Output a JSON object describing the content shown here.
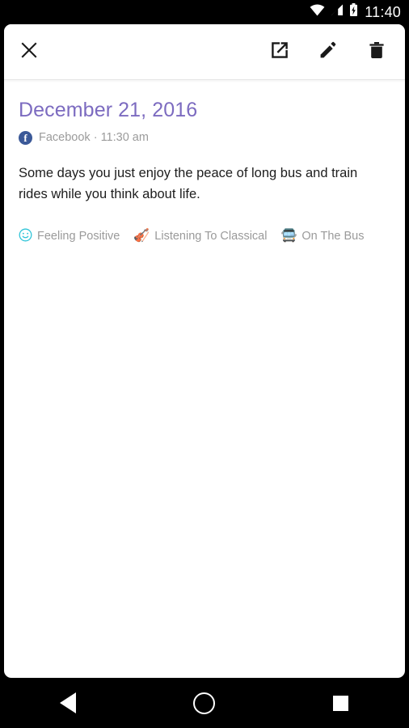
{
  "status_bar": {
    "time": "11:40",
    "icons": [
      "wifi-icon",
      "cellular-signal-icon",
      "battery-charging-icon"
    ]
  },
  "toolbar": {
    "close_label": "close-icon",
    "share_label": "open-in-new-icon",
    "edit_label": "edit-pencil-icon",
    "delete_label": "delete-trash-icon"
  },
  "entry": {
    "title": "December 21, 2016",
    "source": "Facebook",
    "separator": "·",
    "time": "11:30 am",
    "meta": "Facebook · 11:30 am",
    "body": "Some days you just enjoy the peace of long bus and train rides while you think about life.",
    "tags": [
      {
        "icon": "smiley-face-icon",
        "emoji": "☺",
        "label": "Feeling Positive"
      },
      {
        "icon": "violin-icon",
        "emoji": "🎻",
        "label": "Listening To Classical"
      },
      {
        "icon": "bus-icon",
        "emoji": "🚍",
        "label": "On The Bus"
      }
    ]
  },
  "nav_bar": {
    "back_label": "back-button",
    "home_label": "home-button",
    "recents_label": "recents-button"
  },
  "colors": {
    "title_purple": "#7c6bc0",
    "facebook_blue": "#3b5998",
    "muted_gray": "#9a9a9a",
    "smiley_cyan": "#2ec4d8",
    "card_white": "#ffffff",
    "system_black": "#000000"
  }
}
